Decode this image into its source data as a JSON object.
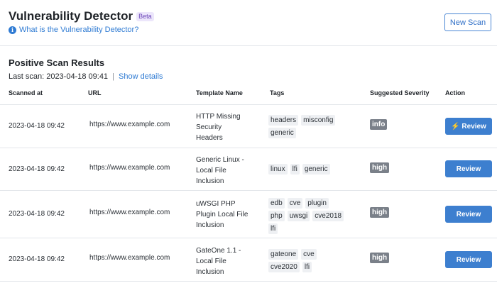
{
  "header": {
    "title": "Vulnerability Detector",
    "beta_badge": "Beta",
    "help_link": "What is the Vulnerability Detector?",
    "new_scan_label": "New Scan"
  },
  "results": {
    "title": "Positive Scan Results",
    "last_scan_label": "Last scan:",
    "last_scan_value": "2023-04-18 09:41",
    "separator": "|",
    "show_details": "Show details"
  },
  "table": {
    "columns": [
      "Scanned at",
      "URL",
      "Template Name",
      "Tags",
      "Suggested Severity",
      "Action"
    ],
    "rows": [
      {
        "scanned_at": "2023-04-18 09:42",
        "url": "https://www.example.com",
        "template": [
          "HTTP Missing",
          "Security",
          "Headers"
        ],
        "tags": [
          "headers",
          "misconfig",
          "generic"
        ],
        "severity": "info",
        "action": "⚡ Review"
      },
      {
        "scanned_at": "2023-04-18 09:42",
        "url": "https://www.example.com",
        "template": [
          "Generic Linux -",
          "Local File",
          "Inclusion"
        ],
        "tags": [
          "linux",
          "lfi",
          "generic"
        ],
        "severity": "high",
        "action": "Review"
      },
      {
        "scanned_at": "2023-04-18 09:42",
        "url": "https://www.example.com",
        "template": [
          "uWSGI PHP",
          "Plugin Local File",
          "Inclusion"
        ],
        "tags": [
          "edb",
          "cve",
          "plugin",
          "php",
          "uwsgi",
          "cve2018",
          "lfi"
        ],
        "severity": "high",
        "action": "Review"
      },
      {
        "scanned_at": "2023-04-18 09:42",
        "url": "https://www.example.com",
        "template": [
          "GateOne 1.1 -",
          "Local File",
          "Inclusion"
        ],
        "tags": [
          "gateone",
          "cve",
          "cve2020",
          "lfi"
        ],
        "severity": "high",
        "action": "Review"
      }
    ]
  },
  "colors": {
    "accent": "#3d7fcf",
    "link": "#2f7bd3",
    "severity_badge": "#7a8089",
    "beta_bg": "#ece6fb"
  }
}
